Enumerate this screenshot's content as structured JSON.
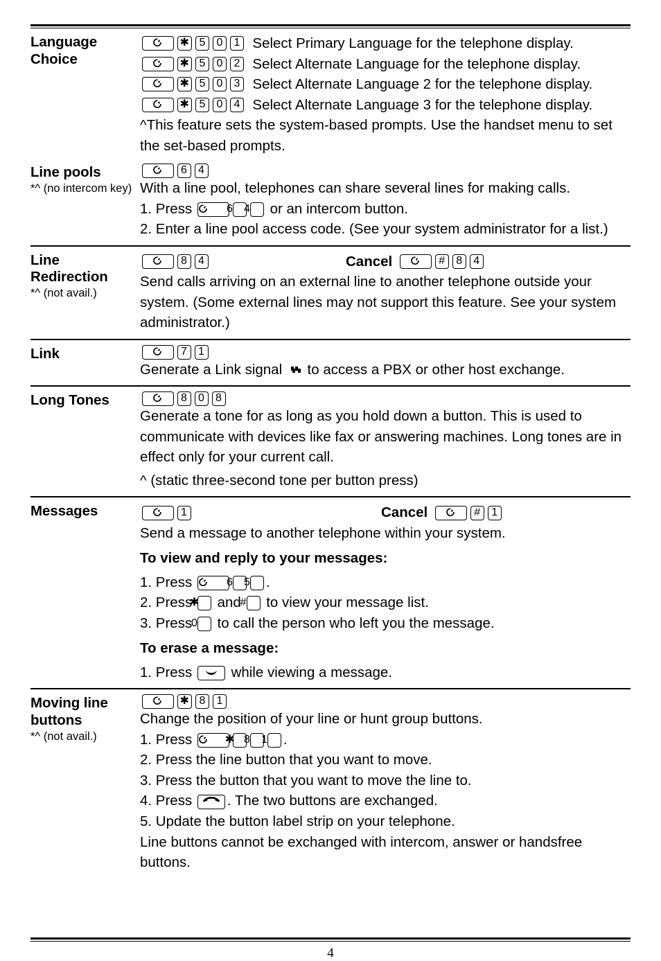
{
  "page": {
    "number": "4",
    "icons": {
      "feature": "feature-key-icon",
      "link_signal": "link-signal-icon",
      "release": "release-key-icon",
      "hold": "hold-key-icon"
    }
  },
  "sections": [
    {
      "title": "Language Choice",
      "note": "",
      "rows": [
        {
          "keys": [
            "FEATURE",
            "*",
            "5",
            "0",
            "1"
          ],
          "desc": "Select Primary Language for the telephone display."
        },
        {
          "keys": [
            "FEATURE",
            "*",
            "5",
            "0",
            "2"
          ],
          "desc": "Select Alternate Language for the telephone display."
        },
        {
          "keys": [
            "FEATURE",
            "*",
            "5",
            "0",
            "3"
          ],
          "desc": "Select Alternate Language 2 for the telephone display."
        },
        {
          "keys": [
            "FEATURE",
            "*",
            "5",
            "0",
            "4"
          ],
          "desc": "Select Alternate Language 3 for the telephone display."
        }
      ],
      "paragraphs": [
        "^This feature sets the system-based prompts. Use the handset menu to set the set-based prompts."
      ]
    },
    {
      "title": "Line pools",
      "note": "*^ (no intercom key)",
      "code_keys": [
        "FEATURE",
        "6",
        "4"
      ],
      "paragraphs": [
        "With a line pool, telephones can share several lines for making calls."
      ],
      "steps": [
        {
          "prefix": "1. Press ",
          "keys": [
            "FEATURE",
            "6",
            "4"
          ],
          "suffix": " or an intercom button."
        },
        {
          "prefix": "2. Enter a line pool access code. (See your system administrator for a list.)",
          "keys": [],
          "suffix": ""
        }
      ]
    },
    {
      "title": "Line Redirection",
      "note": "*^ (not avail.)",
      "code_keys": [
        "FEATURE",
        "8",
        "4"
      ],
      "cancel_label": "Cancel",
      "cancel_keys": [
        "FEATURE",
        "#",
        "8",
        "4"
      ],
      "paragraphs": [
        "Send calls arriving on an external line to another telephone outside your system. (Some external lines may not support this feature. See your system administrator.)"
      ]
    },
    {
      "title": "Link",
      "note": "",
      "code_keys": [
        "FEATURE",
        "7",
        "1"
      ],
      "link_text_before": "Generate a Link signal ",
      "link_text_after": " to access a PBX or other host exchange."
    },
    {
      "title": "Long Tones",
      "note": "",
      "code_keys": [
        "FEATURE",
        "8",
        "0",
        "8"
      ],
      "paragraphs": [
        "Generate a tone for as long as you hold down a button. This is used to communicate with devices like fax or answering machines. Long tones are in effect only for your current call.",
        "^ (static three-second tone per button press)"
      ]
    },
    {
      "title": "Messages",
      "note": "",
      "code_keys": [
        "FEATURE",
        "1"
      ],
      "cancel_label": "Cancel",
      "cancel_keys": [
        "FEATURE",
        "#",
        "1"
      ],
      "intro": "Send a message to another telephone within your system.",
      "sub1_heading": "To view and reply to your messages:",
      "sub1_steps": [
        {
          "prefix": "1. Press ",
          "keys": [
            "FEATURE",
            "6",
            "5"
          ],
          "suffix": "."
        },
        {
          "prefix": "2. Press ",
          "keys": [
            "*"
          ],
          "mid": " and ",
          "keys2": [
            "#"
          ],
          "suffix": " to view your message list."
        },
        {
          "prefix": "3. Press ",
          "keys": [
            "0"
          ],
          "suffix": " to call the person who left you the message."
        }
      ],
      "sub2_heading": "To erase a message:",
      "sub2_steps": [
        {
          "prefix": "1. Press ",
          "keys": [
            "HOLD"
          ],
          "suffix": " while viewing a message."
        }
      ]
    },
    {
      "title": "Moving line buttons",
      "note": "*^ (not avail.)",
      "code_keys": [
        "FEATURE",
        "*",
        "8",
        "1"
      ],
      "intro": "Change the position of your line or hunt group buttons.",
      "steps": [
        {
          "prefix": "1. Press ",
          "keys": [
            "FEATURE",
            "*",
            "8",
            "1"
          ],
          "suffix": "."
        },
        {
          "prefix": "2. Press the line button that you want to move.",
          "keys": [],
          "suffix": ""
        },
        {
          "prefix": "3. Press the button that you want to move the line to.",
          "keys": [],
          "suffix": ""
        },
        {
          "prefix": "4. Press ",
          "keys": [
            "RELEASE"
          ],
          "suffix": ". The two buttons are exchanged."
        },
        {
          "prefix": "5. Update the button label strip on your telephone.",
          "keys": [],
          "suffix": ""
        }
      ],
      "outro": "Line buttons cannot be exchanged with intercom, answer or handsfree buttons."
    }
  ]
}
